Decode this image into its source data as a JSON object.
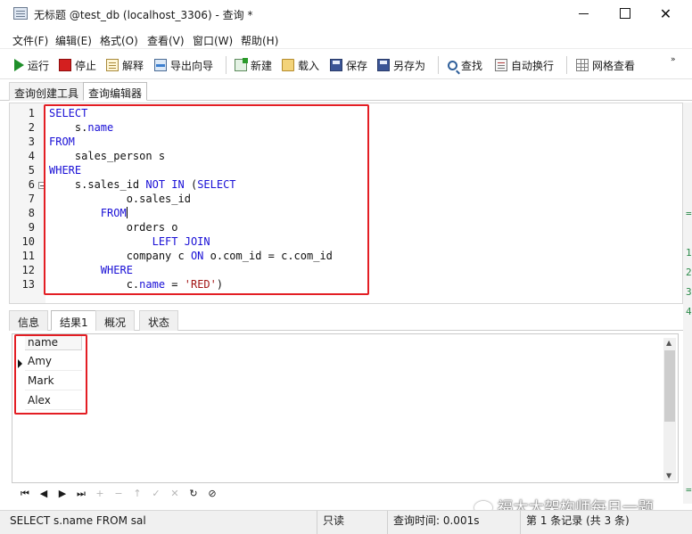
{
  "window": {
    "title": "无标题 @test_db (localhost_3306) - 查询 *",
    "minimize": "",
    "maximize": "",
    "close": "✕"
  },
  "menu": [
    "文件(F)",
    "编辑(E)",
    "格式(O)",
    "查看(V)",
    "窗口(W)",
    "帮助(H)"
  ],
  "toolbar": {
    "run": "运行",
    "stop": "停止",
    "explain": "解释",
    "export": "导出向导",
    "new": "新建",
    "load": "载入",
    "save": "保存",
    "saveas": "另存为",
    "find": "查找",
    "wrap": "自动换行",
    "grid": "网格查看",
    "more": "»"
  },
  "editor_tabs": [
    "查询创建工具",
    "查询编辑器"
  ],
  "editor": {
    "lines": [
      {
        "n": "1",
        "tokens": [
          {
            "t": "SELECT",
            "c": "kw"
          }
        ]
      },
      {
        "n": "2",
        "tokens": [
          {
            "t": "    s.",
            "c": "plain"
          },
          {
            "t": "name",
            "c": "kw"
          }
        ]
      },
      {
        "n": "3",
        "tokens": [
          {
            "t": "FROM",
            "c": "kw"
          }
        ]
      },
      {
        "n": "4",
        "tokens": [
          {
            "t": "    sales_person s",
            "c": "plain"
          }
        ]
      },
      {
        "n": "5",
        "tokens": [
          {
            "t": "WHERE",
            "c": "kw"
          }
        ]
      },
      {
        "n": "6",
        "tokens": [
          {
            "t": "    s.sales_id ",
            "c": "plain"
          },
          {
            "t": "NOT IN",
            "c": "kw"
          },
          {
            "t": " (",
            "c": "plain"
          },
          {
            "t": "SELECT",
            "c": "kw"
          }
        ]
      },
      {
        "n": "7",
        "tokens": [
          {
            "t": "            o.sales_id",
            "c": "plain"
          }
        ]
      },
      {
        "n": "8",
        "tokens": [
          {
            "t": "        ",
            "c": "plain"
          },
          {
            "t": "FROM",
            "c": "kw"
          }
        ]
      },
      {
        "n": "9",
        "tokens": [
          {
            "t": "            orders o",
            "c": "plain"
          }
        ]
      },
      {
        "n": "10",
        "tokens": [
          {
            "t": "                ",
            "c": "plain"
          },
          {
            "t": "LEFT JOIN",
            "c": "kw"
          }
        ]
      },
      {
        "n": "11",
        "tokens": [
          {
            "t": "            company c ",
            "c": "plain"
          },
          {
            "t": "ON",
            "c": "kw"
          },
          {
            "t": " o.com_id = c.com_id",
            "c": "plain"
          }
        ]
      },
      {
        "n": "12",
        "tokens": [
          {
            "t": "        ",
            "c": "plain"
          },
          {
            "t": "WHERE",
            "c": "kw"
          }
        ]
      },
      {
        "n": "13",
        "tokens": [
          {
            "t": "            c.",
            "c": "plain"
          },
          {
            "t": "name",
            "c": "kw"
          },
          {
            "t": " = ",
            "c": "plain"
          },
          {
            "t": "'RED'",
            "c": "str"
          },
          {
            "t": ")",
            "c": "plain"
          }
        ]
      }
    ]
  },
  "side_marks": [
    "=",
    "1",
    "2",
    "3",
    "4",
    "="
  ],
  "result_tabs": [
    "信息",
    "结果1",
    "概况",
    "状态"
  ],
  "result": {
    "column": "name",
    "rows": [
      "Amy",
      "Mark",
      "Alex"
    ]
  },
  "navigator": [
    "⏮",
    "◀",
    "▶",
    "⏭",
    "+",
    "−",
    "↑",
    "✓",
    "✕",
    "↻",
    "⊘"
  ],
  "watermark": "福大大架构师每日一题",
  "status": {
    "sql": "SELECT    s.name FROM    sal",
    "mode": "只读",
    "time": "查询时间: 0.001s",
    "records": "第 1 条记录 (共 3 条)"
  },
  "colors": {
    "keyword": "#1a10d6",
    "string": "#a31515",
    "highlight": "#e31e24",
    "run_icon": "#1f8f2a",
    "stop_icon": "#d41f1f"
  }
}
